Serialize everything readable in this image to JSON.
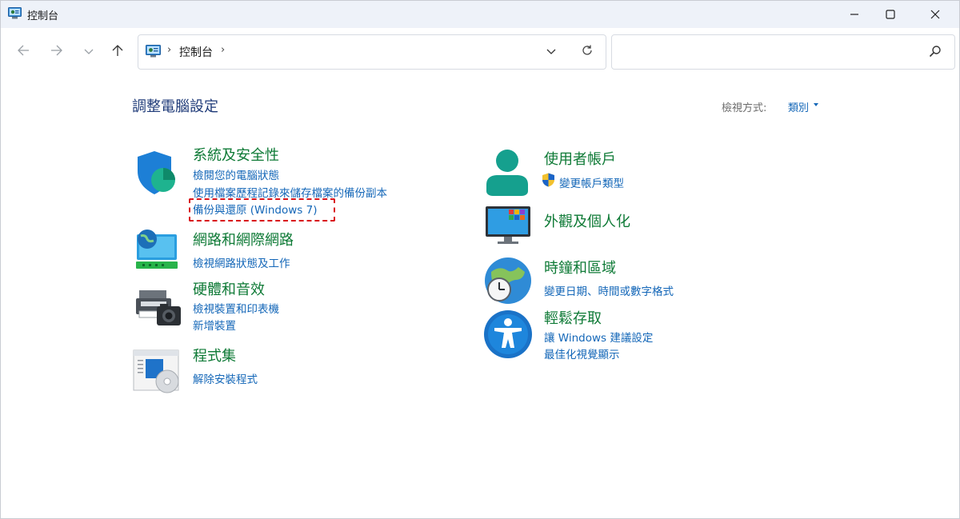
{
  "window": {
    "title": "控制台",
    "buttons": {
      "minimize": "minimize-icon",
      "maximize": "maximize-icon",
      "close": "close-icon"
    }
  },
  "nav": {
    "back": "arrow-left-icon",
    "forward": "arrow-right-icon",
    "recent": "chevron-down-icon",
    "up": "arrow-up-icon"
  },
  "address": {
    "crumbs": [
      "控制台"
    ],
    "separator": "›"
  },
  "search": {
    "placeholder": ""
  },
  "main": {
    "heading": "調整電腦設定",
    "view_by": {
      "label": "檢視方式:",
      "value": "類別"
    },
    "left": [
      {
        "title": "系統及安全性",
        "icon": "shield-icon",
        "links": [
          "檢閱您的電腦狀態",
          "使用檔案歷程記錄來儲存檔案的備份副本",
          "備份與還原 (Windows 7)"
        ]
      },
      {
        "title": "網路和網際網路",
        "icon": "network-globe-icon",
        "links": [
          "檢視網路狀態及工作"
        ]
      },
      {
        "title": "硬體和音效",
        "icon": "printer-camera-icon",
        "links": [
          "檢視裝置和印表機",
          "新增裝置"
        ]
      },
      {
        "title": "程式集",
        "icon": "programs-disc-icon",
        "links": [
          "解除安裝程式"
        ]
      }
    ],
    "right": [
      {
        "title": "使用者帳戶",
        "icon": "user-icon",
        "links": [
          "變更帳戶類型"
        ]
      },
      {
        "title": "外觀及個人化",
        "icon": "monitor-tiles-icon",
        "links": []
      },
      {
        "title": "時鐘和區域",
        "icon": "clock-globe-icon",
        "links": [
          "變更日期、時間或數字格式"
        ]
      },
      {
        "title": "輕鬆存取",
        "icon": "accessibility-icon",
        "links": [
          "讓 Windows 建議設定",
          "最佳化視覺顯示"
        ]
      }
    ]
  },
  "colors": {
    "category_title": "#0e7a36",
    "link": "#1467b8",
    "heading": "#1e3a78",
    "highlight": "#d9161c",
    "titlebar_bg": "#eef2f9"
  }
}
